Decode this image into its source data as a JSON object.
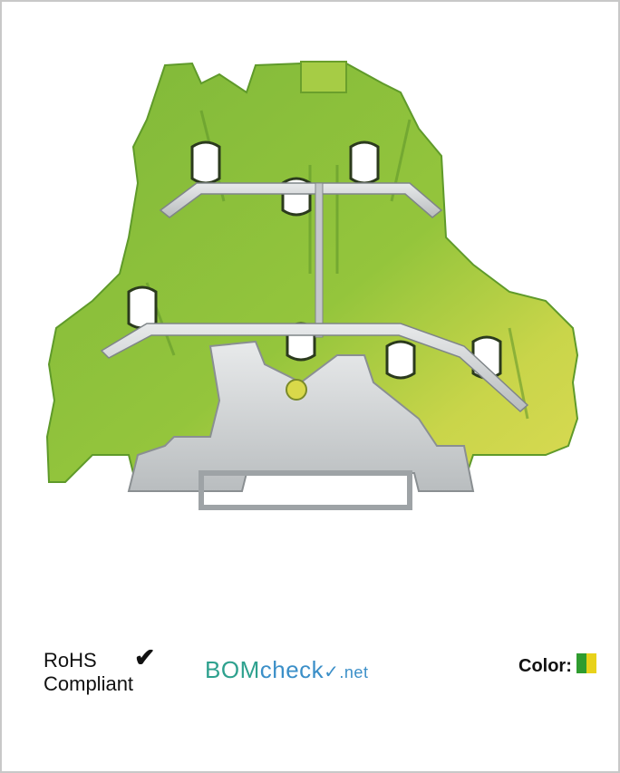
{
  "rohs": {
    "line1": "RoHS",
    "line2": "Compliant",
    "check": "✔"
  },
  "bomcheck": {
    "part_a": "BOM",
    "part_b": "check",
    "tick": "✓",
    "part_c": ".net"
  },
  "color_section": {
    "label": "Color:",
    "swatch_left": "#2f9c2f",
    "swatch_right": "#e8d21a"
  },
  "colors": {
    "housing_green": "#8cbf3a",
    "housing_yellow": "#d6d84a",
    "metal": "#cfd2d4",
    "frame_border": "#c8c8c8"
  }
}
